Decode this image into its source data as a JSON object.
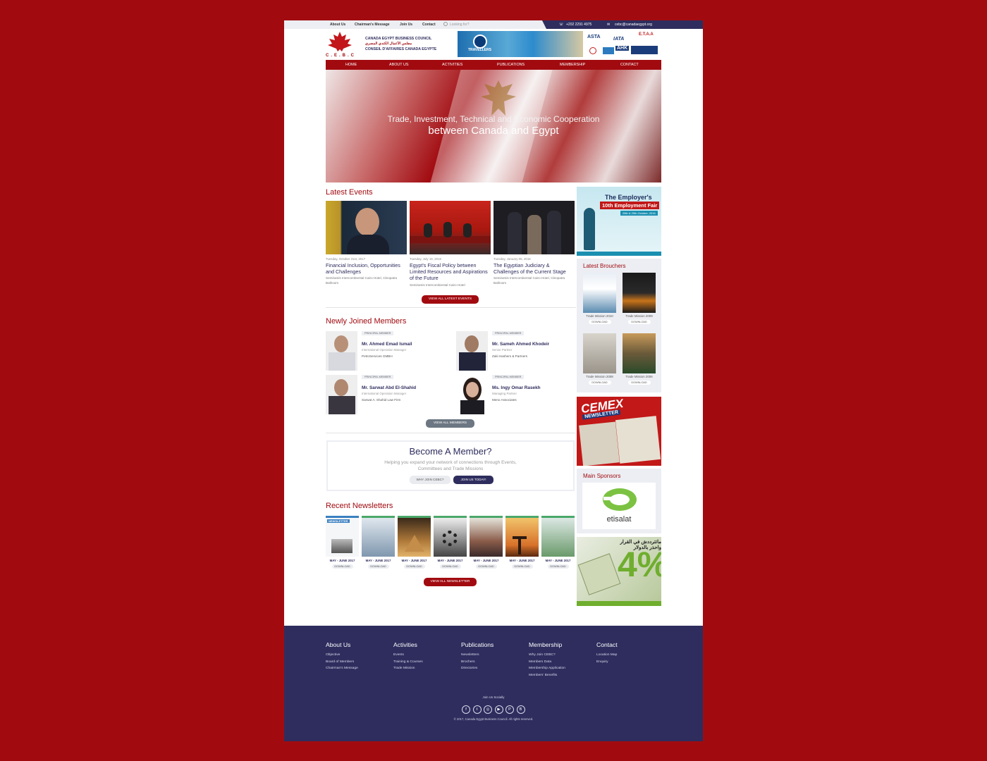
{
  "topbar": {
    "links": [
      "About Us",
      "Chairman's Message",
      "Join Us",
      "Contact"
    ],
    "search_placeholder": "Looking for?",
    "phone": "+202 2291 4975",
    "email": "cebc@canadaegypt.org"
  },
  "header": {
    "logo_text": "C.E.B.C",
    "org_name_en": "CANADA EGYPT BUSINESS COUNCIL",
    "org_name_ar": "مجلس الأعمال الكندي المصري",
    "org_name_fr": "CONSEIL D'AFFAIRES CANADA EGYPTE",
    "banner_text": "TRAVELLERS",
    "associations": [
      "ASTA",
      "IATA",
      "E.T.A.A",
      "AHK"
    ]
  },
  "nav": {
    "items": [
      "HOME",
      "ABOUT US",
      "ACTIVITIES",
      "PUBLICATIONS",
      "MEMBERSHIP",
      "CONTACT"
    ]
  },
  "hero": {
    "line1": "Trade, Investment, Technical and Economic Cooperation",
    "line2": "between Canada and Egypt"
  },
  "events": {
    "title": "Latest Events",
    "items": [
      {
        "date": "Tuesday, October 31st, 2017",
        "title": "Financial Inclusion, Opportunities and Challenges",
        "location": "Semiramis Intercontinental Cairo Hotel, Cleopatra Ballroom"
      },
      {
        "date": "Tuesday, July 19, 2016",
        "title": "Egypt's Fiscal Policy between Limited Resources and Aspirations of the Future",
        "location": "Semiramis Intercontinental Cairo Hotel"
      },
      {
        "date": "Tuesday, January 05, 2016",
        "title": "The Egyptian Judiciary & Challenges of the Current Stage",
        "location": "Semiramis Intercontinental Cairo Hotel, Cleopatra Ballroom"
      }
    ],
    "view_all": "VIEW ALL LATEST EVENTS"
  },
  "members": {
    "title": "Newly Joined Members",
    "items": [
      {
        "badge": "PRINCIPAL MEMBER",
        "name": "Mr. Ahmed Emad Ismail",
        "role": "International Operation Manager",
        "company": "PetroServices GMBH"
      },
      {
        "badge": "PRINCIPAL MEMBER",
        "name": "Mr. Sameh Ahmed Khodeir",
        "role": "Senior Partner",
        "company": "Zaki Hashem & Partners"
      },
      {
        "badge": "PRINCIPAL MEMBER",
        "name": "Mr. Sarwat Abd El-Shahid",
        "role": "International Operation Manager",
        "company": "Sarwat A. Shahid Law Firm"
      },
      {
        "badge": "PRINCIPAL MEMBER",
        "name": "Ms. Ingy Omar Rasekh",
        "role": "Managing Partner",
        "company": "Meno Associates"
      }
    ],
    "view_all": "VIEW ALL MEMBERS"
  },
  "become": {
    "title": "Become A Member?",
    "text_line1": "Helping you expand your network of connections through Events,",
    "text_line2": "Committees and Trade Missions",
    "why_button": "WHY JOIN CEBC?",
    "join_button": "JOIN US TODAY!"
  },
  "newsletters": {
    "title": "Recent Newsletters",
    "items": [
      {
        "label": "MAY - JUNE 2017",
        "download": "DOWNLOAD"
      },
      {
        "label": "MAY - JUNE 2017",
        "download": "DOWNLOAD"
      },
      {
        "label": "MAY - JUNE 2017",
        "download": "DOWNLOAD"
      },
      {
        "label": "MAY - JUNE 2017",
        "download": "DOWNLOAD"
      },
      {
        "label": "MAY - JUNE 2017",
        "download": "DOWNLOAD"
      },
      {
        "label": "MAY - JUNE 2017",
        "download": "DOWNLOAD"
      },
      {
        "label": "MAY - JUNE 2017",
        "download": "DOWNLOAD"
      }
    ],
    "first_cover_text": "NEWSLETTER",
    "view_all": "VIEW ALL NEWSLETTER"
  },
  "sidebar": {
    "fair": {
      "line1": "The Employer's",
      "line2": "10th Employment Fair",
      "line3": "28th & 29th October, 2016"
    },
    "brochures": {
      "title": "Latest Brouchers",
      "items": [
        {
          "caption": "Trade Mission 2010",
          "download": "DOWNLOAD"
        },
        {
          "caption": "Trade Mission 2009",
          "download": "DOWNLOAD"
        },
        {
          "caption": "Trade Mission 2008",
          "download": "DOWNLOAD"
        },
        {
          "caption": "Trade Mission 2006",
          "download": "DOWNLOAD"
        }
      ]
    },
    "cemex": {
      "logo": "CEMEX",
      "subtitle": "NEWSLETTER"
    },
    "sponsors": {
      "title": "Main Sponsors",
      "name": "etisalat"
    },
    "ad": {
      "arabic": "ماتترددش في القرار واحذر بالدولار",
      "percent": "4%"
    }
  },
  "footer": {
    "columns": [
      {
        "heading": "About Us",
        "items": [
          "Objective",
          "Board of Members",
          "Chairman's Message"
        ]
      },
      {
        "heading": "Activities",
        "items": [
          "Events",
          "Training & Courses",
          "Trade Mission"
        ]
      },
      {
        "heading": "Publications",
        "items": [
          "Newsletters",
          "Brochers",
          "Directories"
        ]
      },
      {
        "heading": "Membership",
        "items": [
          "Why Join CEBC?",
          "Members Data",
          "Membership Application",
          "Members' Benefits"
        ]
      },
      {
        "heading": "Contact",
        "items": [
          "Location Map",
          "Enquiry"
        ]
      }
    ],
    "social_title": "Join Us Socially",
    "social_icons": [
      "facebook-icon",
      "twitter-icon",
      "instagram-icon",
      "youtube-icon",
      "pinterest-icon",
      "blogger-icon"
    ],
    "copyright": "© 2017, Canada Egypt Business Council. All rights reserved."
  },
  "colors": {
    "brand_red": "#a10b10",
    "brand_navy": "#2e2d5e",
    "accent_green": "#6fae2e"
  }
}
